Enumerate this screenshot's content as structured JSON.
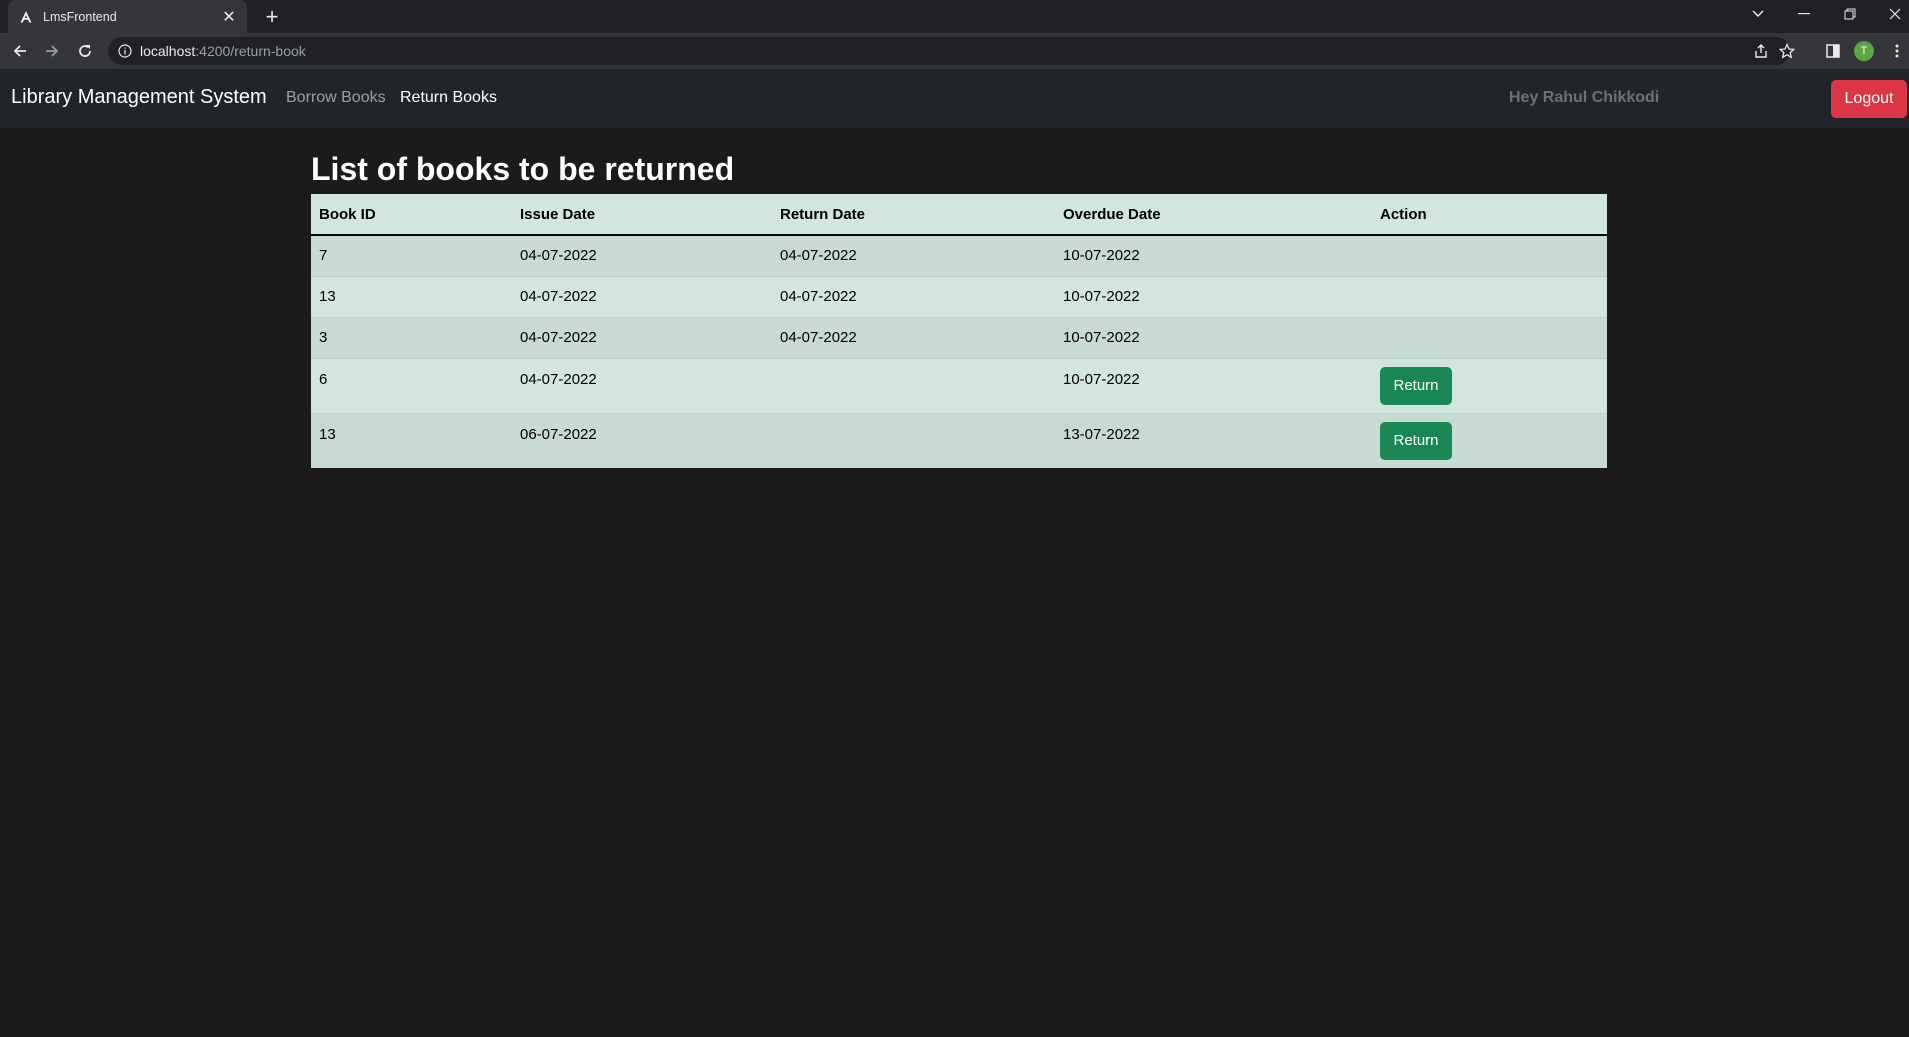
{
  "browser": {
    "tab_title": "LmsFrontend",
    "url_host": "localhost",
    "url_path": ":4200/return-book",
    "profile_initial": "T"
  },
  "navbar": {
    "brand": "Library Management System",
    "links": [
      "Borrow Books",
      "Return Books"
    ],
    "greeting": "Hey Rahul Chikkodi",
    "logout_label": "Logout"
  },
  "page": {
    "title": "List of books to be returned"
  },
  "table": {
    "headers": [
      "Book ID",
      "Issue Date",
      "Return Date",
      "Overdue Date",
      "Action"
    ],
    "rows": [
      {
        "book_id": "7",
        "issue_date": "04-07-2022",
        "return_date": "04-07-2022",
        "overdue_date": "10-07-2022",
        "action": ""
      },
      {
        "book_id": "13",
        "issue_date": "04-07-2022",
        "return_date": "04-07-2022",
        "overdue_date": "10-07-2022",
        "action": ""
      },
      {
        "book_id": "3",
        "issue_date": "04-07-2022",
        "return_date": "04-07-2022",
        "overdue_date": "10-07-2022",
        "action": ""
      },
      {
        "book_id": "6",
        "issue_date": "04-07-2022",
        "return_date": "",
        "overdue_date": "10-07-2022",
        "action": "Return"
      },
      {
        "book_id": "13",
        "issue_date": "06-07-2022",
        "return_date": "",
        "overdue_date": "13-07-2022",
        "action": "Return"
      }
    ]
  },
  "colors": {
    "navbar_bg": "#212529",
    "page_bg": "#1b1b1c",
    "table_row_light": "#d1e7dd",
    "table_row_dark": "#c7dbd2",
    "return_button": "#198754",
    "logout_button": "#dc3545"
  }
}
